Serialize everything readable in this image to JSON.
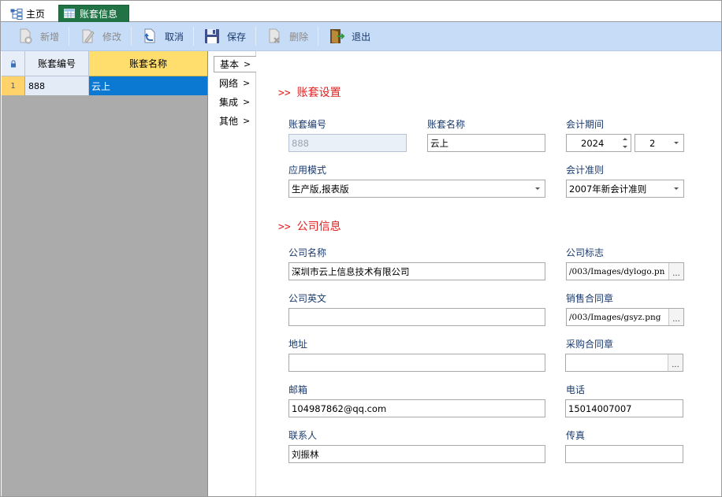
{
  "tabs": {
    "home": "主页",
    "active": "账套信息"
  },
  "toolbar": {
    "new": "新增",
    "edit": "修改",
    "cancel": "取消",
    "save": "保存",
    "delete": "删除",
    "exit": "退出"
  },
  "grid": {
    "columns": [
      "账套编号",
      "账套名称"
    ],
    "rows": [
      {
        "num": "1",
        "code": "888",
        "name": "云上"
      }
    ]
  },
  "side_tabs": [
    "基本",
    "网络",
    "集成",
    "其他"
  ],
  "sections": {
    "account": "账套设置",
    "company": "公司信息",
    "arrows": ">>"
  },
  "form": {
    "account_code": {
      "label": "账套编号",
      "value": "888"
    },
    "account_name": {
      "label": "账套名称",
      "value": "云上"
    },
    "period": {
      "label": "会计期间",
      "year": "2024",
      "month": "2"
    },
    "app_mode": {
      "label": "应用模式",
      "value": "生产版,报表版"
    },
    "standard": {
      "label": "会计准则",
      "value": "2007年新会计准则"
    },
    "company_name": {
      "label": "公司名称",
      "value": "深圳市云上信息技术有限公司"
    },
    "company_logo": {
      "label": "公司标志",
      "value": "/003/Images/dylogo.pn"
    },
    "company_en": {
      "label": "公司英文",
      "value": ""
    },
    "sales_seal": {
      "label": "销售合同章",
      "value": "/003/Images/gsyz.png"
    },
    "address": {
      "label": "地址",
      "value": ""
    },
    "purchase_seal": {
      "label": "采购合同章",
      "value": ""
    },
    "email": {
      "label": "邮箱",
      "value": "104987862@qq.com"
    },
    "phone": {
      "label": "电话",
      "value": "15014007007"
    },
    "contact": {
      "label": "联系人",
      "value": "刘振林"
    },
    "fax": {
      "label": "传真",
      "value": ""
    },
    "ellipsis": "..."
  },
  "colors": {
    "active_tab": "#217346",
    "toolbar": "#c7dcf7",
    "selection": "#0b78d1",
    "section_title": "#e02020",
    "label": "#1a3a6e"
  }
}
